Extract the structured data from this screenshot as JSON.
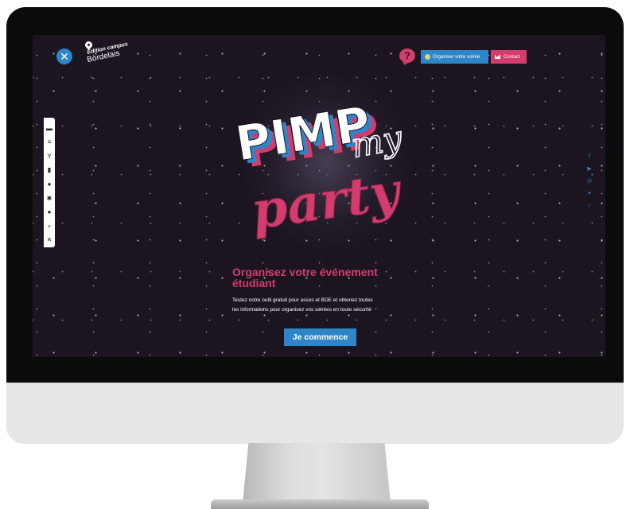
{
  "header": {
    "brand_line1": "Edition campus",
    "brand_line2": "Bordelais",
    "close_glyph": "✕",
    "help_glyph": "?",
    "organise_label": "Organiser votre soirée",
    "contact_label": "Contact"
  },
  "logo": {
    "word1": "PIMP",
    "word2": "my",
    "word3": "party"
  },
  "main": {
    "headline_line1": "Organisez votre événement",
    "headline_line2": "étudiant",
    "desc_line1": "Testez notre outil gratuit pour assos et BDE et obtenez toutes",
    "desc_line2": "les informations pour organisez vos soirées en toute sécurité",
    "cta_label": "Je commence"
  },
  "toolbar": [
    {
      "name": "folder-icon",
      "glyph": "▬"
    },
    {
      "name": "list-edit-icon",
      "glyph": "≡"
    },
    {
      "name": "cocktail-icon",
      "glyph": "Y"
    },
    {
      "name": "bottle-icon",
      "glyph": "▮"
    },
    {
      "name": "palette-icon",
      "glyph": "●"
    },
    {
      "name": "gear-icon",
      "glyph": "✱"
    },
    {
      "name": "info-icon",
      "glyph": "●"
    },
    {
      "name": "broom-icon",
      "glyph": "⌕"
    },
    {
      "name": "tools-icon",
      "glyph": "✕"
    }
  ],
  "social": [
    {
      "name": "facebook-icon",
      "glyph": "f"
    },
    {
      "name": "youtube-icon",
      "glyph": "▶"
    },
    {
      "name": "instagram-icon",
      "glyph": "◎"
    },
    {
      "name": "twitter-icon",
      "glyph": "✦"
    },
    {
      "name": "tiktok-icon",
      "glyph": "♪"
    }
  ],
  "colors": {
    "background": "#1c1520",
    "accent_blue": "#2e86c8",
    "accent_pink": "#d43c6e"
  }
}
